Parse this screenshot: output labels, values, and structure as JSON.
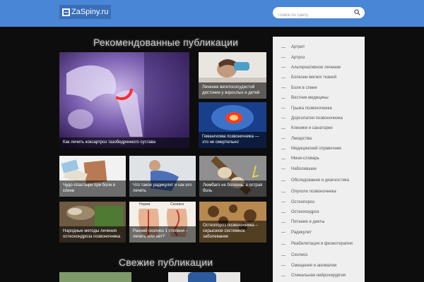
{
  "header": {
    "logo": "ZaSpiny.ru",
    "search_placeholder": "Поиск по сайту"
  },
  "sections": {
    "recommended": "Рекомендованные публикации",
    "fresh": "Свежие публикации"
  },
  "cards": {
    "hip": "Как лечить коксартроз тазобедренного сустава",
    "vsd": "Лечение вегетососудистой дистонии у взрослых и детей",
    "hemangioma": "Гемангиома позвоночника — это не смертельно",
    "plasters": "Чудо-пластыри при боли в спине",
    "radiculitis": "Что такое радикулит и как его лечить",
    "lumbago": "Люмбаго не болезнь, а острая боль",
    "folk": "Народные методы лечения остеохондроза позвоночника",
    "scoliosis": "Ранний сколиоз 1 степени – лечить или нет?",
    "osteoporosis": "Остеопороз позвоночника – серьезное системное заболевание",
    "scoliosis_norm": "Норма",
    "scoliosis_label": "Сколиоз"
  },
  "sidebar": {
    "items": [
      "Артрит",
      "Артроз",
      "Альтернативное лечение",
      "Болезни мягких тканей",
      "Боли в спине",
      "Вестник медицины",
      "Грыжа позвоночника",
      "Дорсопатия позвоночника",
      "Клиники и санатории",
      "Лекарства",
      "Медицинский справочник",
      "Мини-словарь",
      "Наболевшее",
      "Обследование и диагностика",
      "Опухоли позвоночника",
      "Остеопороз",
      "Остеохондроз",
      "Питание и диеты",
      "Радикулит",
      "Реабилитация и физиотерапия",
      "Сколиоз",
      "Смещения и аномалии",
      "Спинальная нейрохирургия"
    ]
  },
  "colors": {
    "header": "#4a86d6",
    "background": "#0d0d0d",
    "sidebar": "#efefef"
  }
}
